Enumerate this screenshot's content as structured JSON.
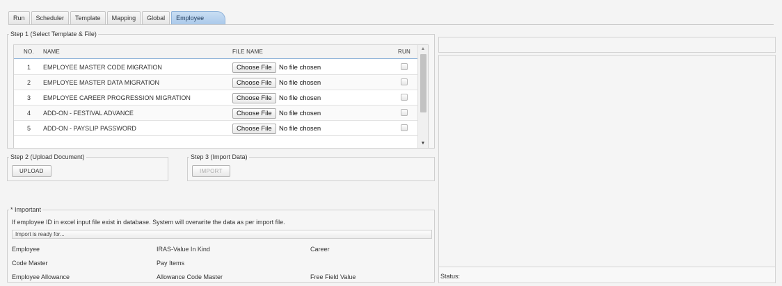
{
  "tabs": [
    "Run",
    "Scheduler",
    "Template",
    "Mapping",
    "Global",
    "Employee"
  ],
  "step1": {
    "legend": "Step 1 (Select Template & File)",
    "columns": {
      "no": "NO.",
      "name": "NAME",
      "file": "FILE NAME",
      "run": "RUN"
    },
    "rows": [
      {
        "no": "1",
        "name": "EMPLOYEE MASTER CODE MIGRATION",
        "button": "Choose File",
        "file": "No file chosen"
      },
      {
        "no": "2",
        "name": "EMPLOYEE MASTER DATA MIGRATION",
        "button": "Choose File",
        "file": "No file chosen"
      },
      {
        "no": "3",
        "name": "EMPLOYEE CAREER PROGRESSION MIGRATION",
        "button": "Choose File",
        "file": "No file chosen"
      },
      {
        "no": "4",
        "name": "ADD-ON - FESTIVAL ADVANCE",
        "button": "Choose File",
        "file": "No file chosen"
      },
      {
        "no": "5",
        "name": "ADD-ON - PAYSLIP PASSWORD",
        "button": "Choose File",
        "file": "No file chosen"
      }
    ]
  },
  "step2": {
    "legend": "Step 2 (Upload Document)",
    "button": "UPLOAD"
  },
  "step3": {
    "legend": "Step 3 (Import Data)",
    "button": "IMPORT"
  },
  "important": {
    "legend": "* Important",
    "message": "If employee ID in excel input file exist in database. System will overwrite the data as per import file.",
    "ready": "Import is ready for...",
    "items": [
      [
        "Employee",
        "IRAS-Value In Kind",
        "Career"
      ],
      [
        "Code Master",
        "Pay Items",
        ""
      ],
      [
        "Employee Allowance",
        "Allowance Code Master",
        "Free Field Value"
      ]
    ]
  },
  "status": {
    "label": "Status:"
  }
}
